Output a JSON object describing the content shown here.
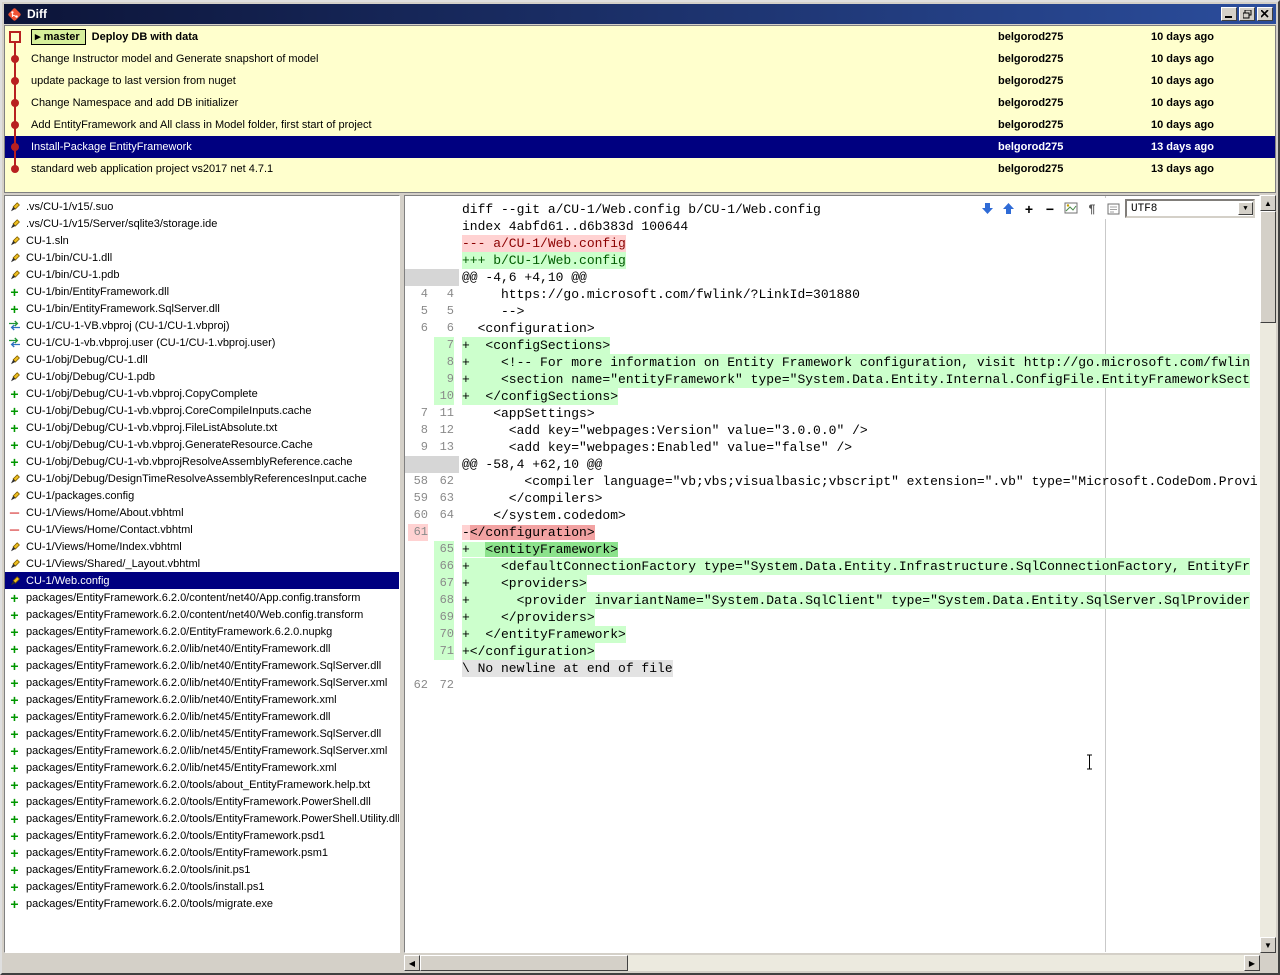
{
  "window": {
    "title": "Diff"
  },
  "icons": {
    "badge_arrow": "▸",
    "combo_arrow": "▼",
    "scroll_up": "▲",
    "scroll_down": "▼",
    "scroll_left": "◀",
    "scroll_right": "▶",
    "pilcrow": "¶",
    "zoom_in": "+",
    "zoom_out": "−"
  },
  "colors": {
    "graph": "#b82020",
    "selection": "#000080",
    "commit_bg": "#ffffcd",
    "add_bg": "#ccffcc",
    "del_bg": "#ffd2d2"
  },
  "commits": {
    "rows": [
      {
        "marker": "square",
        "badge": "master",
        "subject": "Deploy DB with data",
        "author": "belgorod275",
        "date": "10 days ago",
        "bold": true
      },
      {
        "marker": "circle",
        "subject": "Change Instructor model and Generate snapshort of model",
        "author": "belgorod275",
        "date": "10 days ago"
      },
      {
        "marker": "circle",
        "subject": "update package to last version from nuget",
        "author": "belgorod275",
        "date": "10 days ago"
      },
      {
        "marker": "circle",
        "subject": "Change Namespace and add DB initializer",
        "author": "belgorod275",
        "date": "10 days ago"
      },
      {
        "marker": "circle",
        "subject": "Add EntityFramework and All class in Model folder, first start of project",
        "author": "belgorod275",
        "date": "10 days ago"
      },
      {
        "marker": "circle",
        "subject": "Install-Package EntityFramework",
        "author": "belgorod275",
        "date": "13 days ago",
        "selected": true
      },
      {
        "marker": "circle",
        "subject": "standard web application project vs2017 net 4.7.1",
        "author": "belgorod275",
        "date": "13 days ago"
      }
    ]
  },
  "files": {
    "items": [
      {
        "status": "modified",
        "path": ".vs/CU-1/v15/.suo"
      },
      {
        "status": "modified",
        "path": ".vs/CU-1/v15/Server/sqlite3/storage.ide"
      },
      {
        "status": "modified",
        "path": "CU-1.sln"
      },
      {
        "status": "modified",
        "path": "CU-1/bin/CU-1.dll"
      },
      {
        "status": "modified",
        "path": "CU-1/bin/CU-1.pdb"
      },
      {
        "status": "added",
        "path": "CU-1/bin/EntityFramework.dll"
      },
      {
        "status": "added",
        "path": "CU-1/bin/EntityFramework.SqlServer.dll"
      },
      {
        "status": "renamed",
        "path": "CU-1/CU-1-VB.vbproj (CU-1/CU-1.vbproj)"
      },
      {
        "status": "renamed",
        "path": "CU-1/CU-1-vb.vbproj.user (CU-1/CU-1.vbproj.user)"
      },
      {
        "status": "modified",
        "path": "CU-1/obj/Debug/CU-1.dll"
      },
      {
        "status": "modified",
        "path": "CU-1/obj/Debug/CU-1.pdb"
      },
      {
        "status": "added",
        "path": "CU-1/obj/Debug/CU-1-vb.vbproj.CopyComplete"
      },
      {
        "status": "added",
        "path": "CU-1/obj/Debug/CU-1-vb.vbproj.CoreCompileInputs.cache"
      },
      {
        "status": "added",
        "path": "CU-1/obj/Debug/CU-1-vb.vbproj.FileListAbsolute.txt"
      },
      {
        "status": "added",
        "path": "CU-1/obj/Debug/CU-1-vb.vbproj.GenerateResource.Cache"
      },
      {
        "status": "added",
        "path": "CU-1/obj/Debug/CU-1-vb.vbprojResolveAssemblyReference.cache"
      },
      {
        "status": "modified",
        "path": "CU-1/obj/Debug/DesignTimeResolveAssemblyReferencesInput.cache"
      },
      {
        "status": "modified",
        "path": "CU-1/packages.config"
      },
      {
        "status": "deleted",
        "path": "CU-1/Views/Home/About.vbhtml"
      },
      {
        "status": "deleted",
        "path": "CU-1/Views/Home/Contact.vbhtml"
      },
      {
        "status": "modified",
        "path": "CU-1/Views/Home/Index.vbhtml"
      },
      {
        "status": "modified",
        "path": "CU-1/Views/Shared/_Layout.vbhtml"
      },
      {
        "status": "modified",
        "path": "CU-1/Web.config",
        "selected": true
      },
      {
        "status": "added",
        "path": "packages/EntityFramework.6.2.0/content/net40/App.config.transform"
      },
      {
        "status": "added",
        "path": "packages/EntityFramework.6.2.0/content/net40/Web.config.transform"
      },
      {
        "status": "added",
        "path": "packages/EntityFramework.6.2.0/EntityFramework.6.2.0.nupkg"
      },
      {
        "status": "added",
        "path": "packages/EntityFramework.6.2.0/lib/net40/EntityFramework.dll"
      },
      {
        "status": "added",
        "path": "packages/EntityFramework.6.2.0/lib/net40/EntityFramework.SqlServer.dll"
      },
      {
        "status": "added",
        "path": "packages/EntityFramework.6.2.0/lib/net40/EntityFramework.SqlServer.xml"
      },
      {
        "status": "added",
        "path": "packages/EntityFramework.6.2.0/lib/net40/EntityFramework.xml"
      },
      {
        "status": "added",
        "path": "packages/EntityFramework.6.2.0/lib/net45/EntityFramework.dll"
      },
      {
        "status": "added",
        "path": "packages/EntityFramework.6.2.0/lib/net45/EntityFramework.SqlServer.dll"
      },
      {
        "status": "added",
        "path": "packages/EntityFramework.6.2.0/lib/net45/EntityFramework.SqlServer.xml"
      },
      {
        "status": "added",
        "path": "packages/EntityFramework.6.2.0/lib/net45/EntityFramework.xml"
      },
      {
        "status": "added",
        "path": "packages/EntityFramework.6.2.0/tools/about_EntityFramework.help.txt"
      },
      {
        "status": "added",
        "path": "packages/EntityFramework.6.2.0/tools/EntityFramework.PowerShell.dll"
      },
      {
        "status": "added",
        "path": "packages/EntityFramework.6.2.0/tools/EntityFramework.PowerShell.Utility.dll"
      },
      {
        "status": "added",
        "path": "packages/EntityFramework.6.2.0/tools/EntityFramework.psd1"
      },
      {
        "status": "added",
        "path": "packages/EntityFramework.6.2.0/tools/EntityFramework.psm1"
      },
      {
        "status": "added",
        "path": "packages/EntityFramework.6.2.0/tools/init.ps1"
      },
      {
        "status": "added",
        "path": "packages/EntityFramework.6.2.0/tools/install.ps1"
      },
      {
        "status": "added",
        "path": "packages/EntityFramework.6.2.0/tools/migrate.exe"
      }
    ]
  },
  "diff": {
    "toolbar": {
      "encoding": "UTF8"
    },
    "lines": [
      {
        "t": "meta",
        "text": "diff --git a/CU-1/Web.config b/CU-1/Web.config"
      },
      {
        "t": "meta",
        "text": "index 4abfd61..d6b383d 100644"
      },
      {
        "t": "del-file",
        "text": "--- a/CU-1/Web.config"
      },
      {
        "t": "add-file",
        "text": "+++ b/CU-1/Web.config"
      },
      {
        "t": "hunk",
        "text": "@@ -4,6 +4,10 @@"
      },
      {
        "t": "ctx",
        "old": "4",
        "new": "4",
        "text": "     https://go.microsoft.com/fwlink/?LinkId=301880"
      },
      {
        "t": "ctx",
        "old": "5",
        "new": "5",
        "text": "     -->"
      },
      {
        "t": "ctx",
        "old": "6",
        "new": "6",
        "text": "  <configuration>"
      },
      {
        "t": "add",
        "new": "7",
        "text": "+  <configSections>"
      },
      {
        "t": "add",
        "new": "8",
        "text": "+    <!-- For more information on Entity Framework configuration, visit http://go.microsoft.com/fwlin"
      },
      {
        "t": "add",
        "new": "9",
        "text": "+    <section name=\"entityFramework\" type=\"System.Data.Entity.Internal.ConfigFile.EntityFrameworkSect"
      },
      {
        "t": "add",
        "new": "10",
        "text": "+  </configSections>"
      },
      {
        "t": "ctx",
        "old": "7",
        "new": "11",
        "text": "    <appSettings>"
      },
      {
        "t": "ctx",
        "old": "8",
        "new": "12",
        "text": "      <add key=\"webpages:Version\" value=\"3.0.0.0\" />"
      },
      {
        "t": "ctx",
        "old": "9",
        "new": "13",
        "text": "      <add key=\"webpages:Enabled\" value=\"false\" />"
      },
      {
        "t": "hunk",
        "text": "@@ -58,4 +62,10 @@"
      },
      {
        "t": "ctx",
        "old": "58",
        "new": "62",
        "text": "        <compiler language=\"vb;vbs;visualbasic;vbscript\" extension=\".vb\" type=\"Microsoft.CodeDom.Provi"
      },
      {
        "t": "ctx",
        "old": "59",
        "new": "63",
        "text": "      </compilers>"
      },
      {
        "t": "ctx",
        "old": "60",
        "new": "64",
        "text": "    </system.codedom>"
      },
      {
        "t": "del",
        "old": "61",
        "pre": "-",
        "hl": "</configuration>"
      },
      {
        "t": "add",
        "new": "65",
        "pre": "+  ",
        "hl": "<entityFramework>"
      },
      {
        "t": "add",
        "new": "66",
        "text": "+    <defaultConnectionFactory type=\"System.Data.Entity.Infrastructure.SqlConnectionFactory, EntityFr"
      },
      {
        "t": "add",
        "new": "67",
        "text": "+    <providers>"
      },
      {
        "t": "add",
        "new": "68",
        "text": "+      <provider invariantName=\"System.Data.SqlClient\" type=\"System.Data.Entity.SqlServer.SqlProvider"
      },
      {
        "t": "add",
        "new": "69",
        "text": "+    </providers>"
      },
      {
        "t": "add",
        "new": "70",
        "text": "+  </entityFramework>"
      },
      {
        "t": "add",
        "new": "71",
        "text": "+</configuration>"
      },
      {
        "t": "note",
        "text": "\\ No newline at end of file"
      },
      {
        "t": "ctx",
        "old": "62",
        "new": "72",
        "text": ""
      }
    ]
  }
}
